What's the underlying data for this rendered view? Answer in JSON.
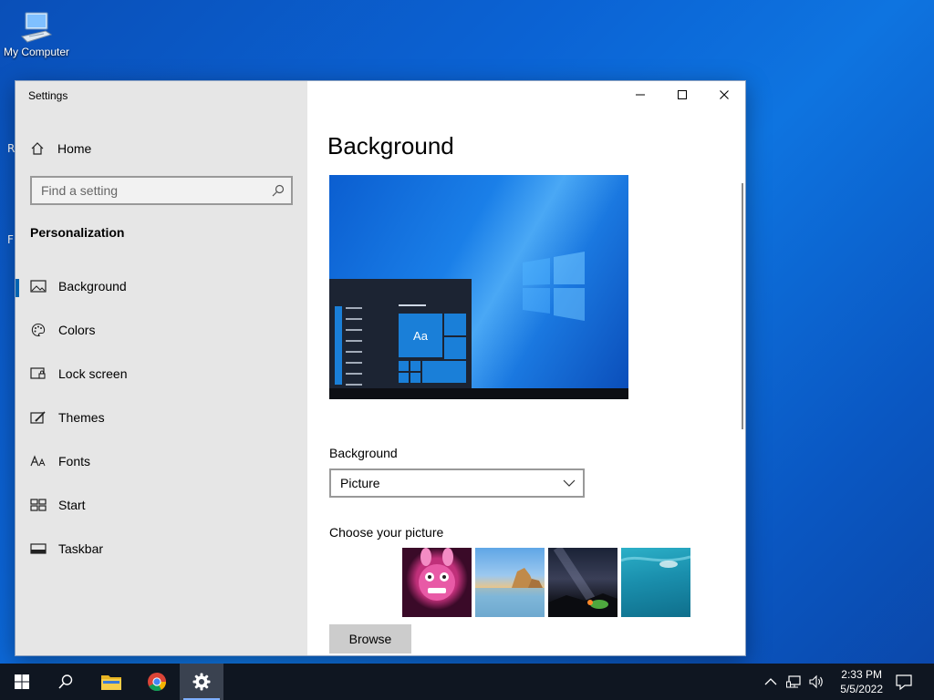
{
  "desktop": {
    "icons": [
      {
        "label": "My Computer",
        "icon": "computer-icon"
      }
    ],
    "edge_letters": [
      "R",
      "F"
    ]
  },
  "window": {
    "title": "Settings",
    "controls": [
      "minimize-icon",
      "maximize-icon",
      "close-icon"
    ]
  },
  "nav": {
    "home_label": "Home",
    "search_placeholder": "Find a setting",
    "section_title": "Personalization",
    "items": [
      {
        "label": "Background",
        "icon": "picture-icon",
        "active": true
      },
      {
        "label": "Colors",
        "icon": "palette-icon",
        "active": false
      },
      {
        "label": "Lock screen",
        "icon": "lock-screen-icon",
        "active": false
      },
      {
        "label": "Themes",
        "icon": "themes-icon",
        "active": false
      },
      {
        "label": "Fonts",
        "icon": "fonts-icon",
        "active": false
      },
      {
        "label": "Start",
        "icon": "start-icon",
        "active": false
      },
      {
        "label": "Taskbar",
        "icon": "taskbar-icon",
        "active": false
      }
    ]
  },
  "main": {
    "title": "Background",
    "preview_tile_text": "Aa",
    "background_label": "Background",
    "background_value": "Picture",
    "choose_label": "Choose your picture",
    "browse_label": "Browse"
  },
  "taskbar": {
    "time": "2:33 PM",
    "date": "5/5/2022",
    "apps": [
      "start-icon",
      "search-icon",
      "file-explorer-icon",
      "chrome-icon",
      "settings-gear-icon"
    ]
  },
  "colors": {
    "accent": "#0063b1",
    "nav_bg": "#e6e6e6",
    "taskbar_bg": "#0f1621"
  }
}
